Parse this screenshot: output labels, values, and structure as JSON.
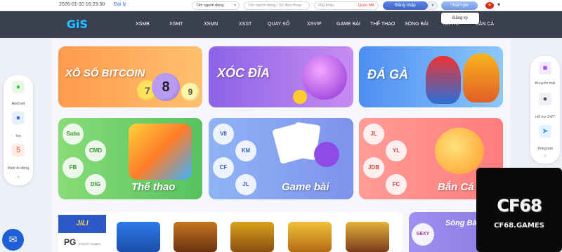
{
  "topbar": {
    "datetime": "2026-01-10 16:23:30",
    "agent_link": "Đại lý",
    "username_placeholder": "Tên người dùng",
    "password_placeholder": "Tên người dùng / Số điện thoại",
    "pass2_placeholder": "Mật khẩu",
    "forgot_label": "Quên MK",
    "login_label": "Đăng nhập",
    "join_label": "Tham gia",
    "signup_label": "Đăng ký",
    "dropdown_caret": "▾"
  },
  "logo": "GiS",
  "nav": {
    "items": [
      "XSMB",
      "XSMT",
      "XSMN",
      "XSST",
      "QUAY SỐ",
      "XSVIP",
      "GAME BÀI",
      "THỂ THAO",
      "SÒNG BÀI",
      "NỔ HŨ",
      "BẮN CÁ"
    ]
  },
  "cards": {
    "lottery_title": "XỔ SỐ BITCOIN",
    "lottery_balls": [
      "7",
      "8",
      "9"
    ],
    "xocdia_title": "XÓC ĐĨA",
    "cockfight_title": "ĐÁ GÀ",
    "sports_title": "Thể thao",
    "sports_providers": [
      "Saba",
      "CMD",
      "FB",
      "DIG"
    ],
    "cards_title": "Game bài",
    "cards_providers": [
      "V8",
      "KM",
      "CF",
      "JL"
    ],
    "fishing_title": "Bắn Cá",
    "fishing_providers": [
      "JL",
      "YL",
      "JDB",
      "FC"
    ],
    "casino_title": "Sòng Bài",
    "casino_provider": "SEXY"
  },
  "left_panel": {
    "items": [
      {
        "icon": "android-icon",
        "label": "Android"
      },
      {
        "icon": "apple-icon",
        "label": "Ios"
      },
      {
        "icon": "html5-icon",
        "label": "Web di động"
      }
    ],
    "close": "×"
  },
  "right_panel": {
    "items": [
      {
        "icon": "gift-icon",
        "label": "Khuyến mãi"
      },
      {
        "icon": "support-icon",
        "label": "Hỗ trợ 24/7"
      },
      {
        "icon": "telegram-icon",
        "label": "Telegram"
      }
    ],
    "close": "×"
  },
  "slot_providers": {
    "jili": "JILI",
    "pg": "PG",
    "pg_sub": "POCKET GAMES"
  },
  "watermark": {
    "big": "CF68",
    "small": "CF68.GAMES"
  },
  "colors": {
    "nav_bg": "#3b4150",
    "login_btn": "#3f63c8",
    "accent": "#27c3ff"
  }
}
